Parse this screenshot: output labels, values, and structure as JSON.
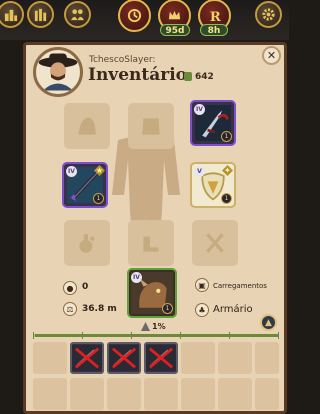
{
  "hud": {
    "buttons": [
      "city-icon",
      "building-icon",
      "group-icon",
      "timer-icon",
      "crown-icon",
      "rank-icon",
      "settings-icon"
    ],
    "pill_left": "95d",
    "pill_right": "8h"
  },
  "profile": {
    "username": "TchescoSlayer:",
    "title": "Inventário",
    "weight": "642"
  },
  "equipment": {
    "head": {
      "icon": "hood-icon",
      "state": "empty"
    },
    "chest": {
      "icon": "chest-icon",
      "state": "empty"
    },
    "cape": {
      "icon": "cape-icon",
      "state": "empty"
    },
    "weapon": {
      "tier": "IV",
      "qty": "1",
      "icon": "staff-icon",
      "rarity": "epic"
    },
    "offhand": {
      "tier": "V",
      "qty": "1",
      "icon": "shield-icon",
      "rarity": "gold"
    },
    "armor_right": {
      "tier": "IV",
      "qty": "1",
      "icon": "sword-icon",
      "rarity": "epic"
    },
    "potion": {
      "icon": "potion-icon",
      "state": "empty"
    },
    "food": {
      "icon": "food-icon",
      "state": "empty"
    },
    "mount": {
      "tier": "IV",
      "qty": "1",
      "icon": "mount-icon",
      "rarity": "green"
    }
  },
  "stats": {
    "silver": "0",
    "silver_icon": "coin-icon",
    "weight_total": "36.8 m",
    "weight_icon": "scale-icon",
    "loadouts": "Carregamentos",
    "loadouts_icon": "backpack-icon",
    "wardrobe": "Armário",
    "wardrobe_icon": "wardrobe-icon"
  },
  "capacity": {
    "percent_text": "1%",
    "fill_fraction": 0.01
  },
  "inventory": {
    "items": [
      {
        "icon": "broken-item-icon",
        "broken": true
      },
      {
        "icon": "broken-item-icon",
        "broken": true
      },
      {
        "icon": "broken-item-icon",
        "broken": true
      }
    ]
  },
  "colors": {
    "panel_bg": "#e8d3b4",
    "panel_border": "#5a3a22",
    "epic_border": "#7a4fd1",
    "gold_border": "#cbb266",
    "green_border": "#5aa23a",
    "capacity_bar": "#6d8a3b"
  }
}
